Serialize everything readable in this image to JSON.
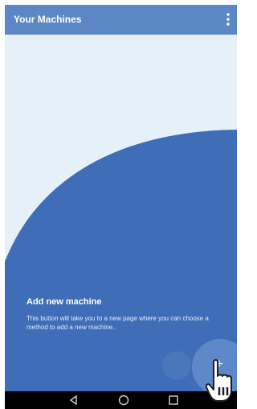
{
  "appbar": {
    "title": "Your Machines",
    "menu_icon": "overflow-menu-icon"
  },
  "tour": {
    "heading": "Add new machine",
    "description": "This button will take you to a new page where you can choose a method to add a new machine.."
  },
  "fab": {
    "label": "+",
    "icon": "add-icon"
  },
  "navbar": {
    "back_icon": "back-triangle-icon",
    "home_icon": "home-circle-icon",
    "recents_icon": "recents-square-icon"
  },
  "colors": {
    "appbar": "#5b88c5",
    "content_bg": "#e6f0f9",
    "overlay": "#3f6db8",
    "navbar": "#000000"
  }
}
